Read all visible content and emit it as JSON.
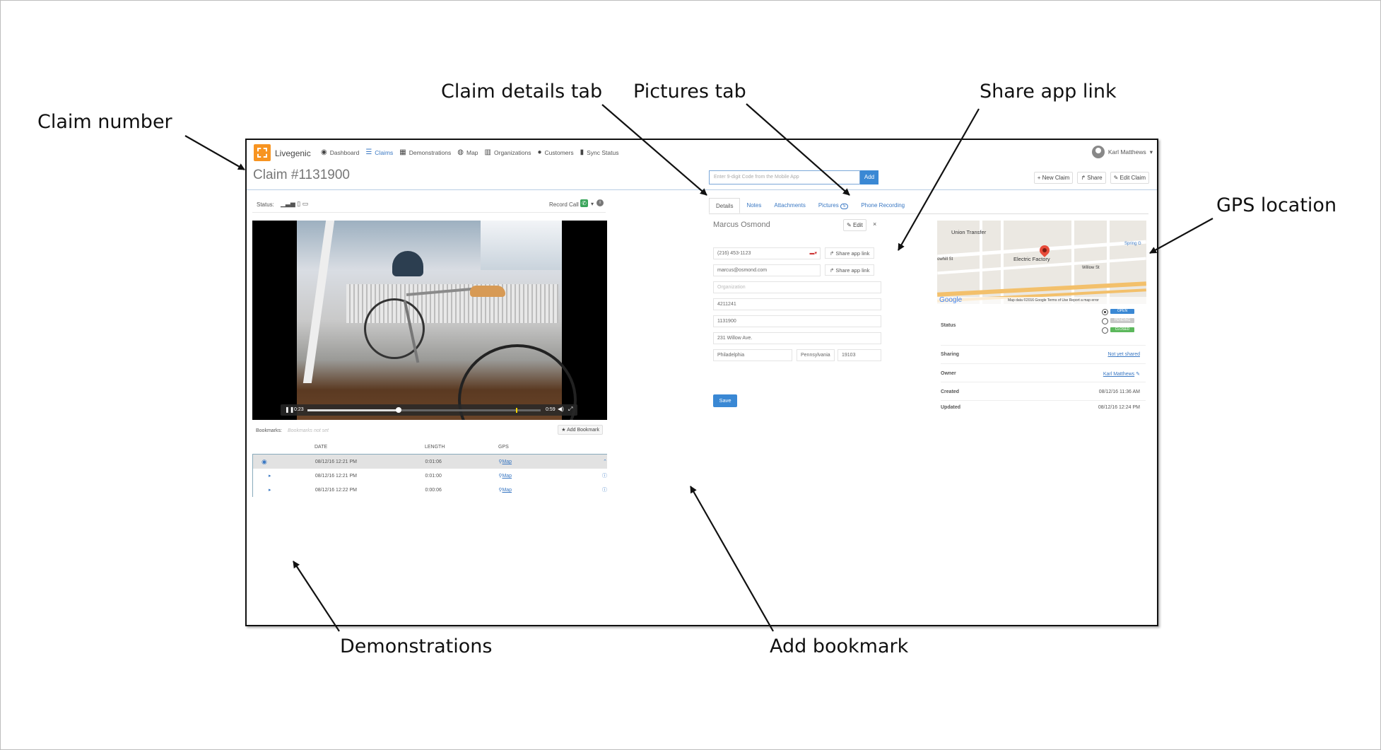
{
  "callouts": {
    "claim_number": "Claim number",
    "claim_details_tab": "Claim details tab",
    "pictures_tab": "Pictures tab",
    "share_app_link": "Share app link",
    "gps_location": "GPS location",
    "demonstrations": "Demonstrations",
    "add_bookmark": "Add bookmark"
  },
  "nav": {
    "brand": "Livegenic",
    "items": [
      {
        "label": "Dashboard",
        "icon": "dashboard-icon"
      },
      {
        "label": "Claims",
        "icon": "claims-icon",
        "active": true
      },
      {
        "label": "Demonstrations",
        "icon": "film-icon"
      },
      {
        "label": "Map",
        "icon": "globe-icon"
      },
      {
        "label": "Organizations",
        "icon": "building-icon"
      },
      {
        "label": "Customers",
        "icon": "user-icon"
      },
      {
        "label": "Sync Status",
        "icon": "bar-chart-icon"
      }
    ],
    "user": "Karl Matthews"
  },
  "header": {
    "claim_title": "Claim #1131900",
    "code_placeholder": "Enter 9-digit Code from the Mobile App",
    "add_label": "Add",
    "new_claim": "New Claim",
    "share": "Share",
    "edit_claim": "Edit Claim"
  },
  "left": {
    "status_label": "Status:",
    "record_call": "Record Call",
    "video": {
      "current_time": "0:23",
      "duration": "0:59",
      "progress": 0.39
    },
    "bookmarks_label": "Bookmarks:",
    "bookmarks_empty": "Bookmarks not set",
    "add_bookmark": "Add Bookmark",
    "table": {
      "headers": [
        "DATE",
        "LENGTH",
        "GPS"
      ],
      "rows": [
        {
          "date": "08/12/16 12:21 PM",
          "length": "0:01:06",
          "gps": "Map"
        },
        {
          "date": "08/12/16 12:21 PM",
          "length": "0:01:00",
          "gps": "Map"
        },
        {
          "date": "08/12/16 12:22 PM",
          "length": "0:00:06",
          "gps": "Map"
        }
      ]
    }
  },
  "tabs": {
    "details": "Details",
    "notes": "Notes",
    "attachments": "Attachments",
    "pictures": "Pictures",
    "pictures_count": "5",
    "phone_recording": "Phone Recording"
  },
  "details": {
    "name": "Marcus Osmond",
    "edit": "Edit",
    "phone": "(216) 453-1123",
    "email": "marcus@osmond.com",
    "share_app_link": "Share app link",
    "organization_placeholder": "Organization",
    "policy": "4211241",
    "claim_no": "1131900",
    "address": "231 Willow Ave.",
    "city": "Philadelphia",
    "state": "Pennsylvania",
    "zip": "19103",
    "save": "Save"
  },
  "map": {
    "labels": {
      "union_transfer": "Union Transfer",
      "electric_factory": "Electric Factory",
      "willow": "Willow St",
      "spring": "Spring G",
      "callowhill": "owhill St",
      "google": "Google",
      "footer": "Map data ©2016 Google   Terms of Use   Report a map error"
    }
  },
  "props": {
    "status_label": "Status",
    "statuses": [
      {
        "label": "OPEN",
        "color": "#3a88d4",
        "selected": true
      },
      {
        "label": "PENDING",
        "color": "#c8c8c8",
        "selected": false
      },
      {
        "label": "CLOSED",
        "color": "#5cb85c",
        "selected": false
      }
    ],
    "sharing_label": "Sharing",
    "sharing_value": "Not yet shared",
    "owner_label": "Owner",
    "owner_value": "Karl Matthews",
    "created_label": "Created",
    "created_value": "08/12/16 11:36 AM",
    "updated_label": "Updated",
    "updated_value": "08/12/16 12:24 PM"
  },
  "colors": {
    "accent": "#3a88d4",
    "brand": "#f79421"
  }
}
